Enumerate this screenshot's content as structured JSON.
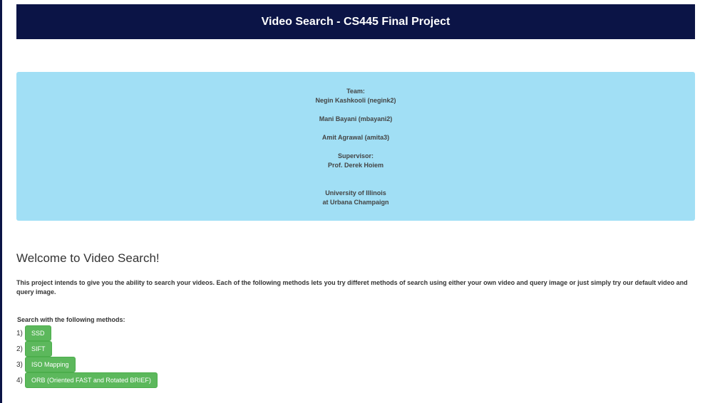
{
  "header": {
    "title": "Video Search - CS445 Final Project"
  },
  "team_box": {
    "team_label": "Team:",
    "members": [
      "Negin Kashkooli (negink2)",
      "Mani Bayani (mbayani2)",
      "Amit Agrawal (amita3)"
    ],
    "supervisor_label": "Supervisor:",
    "supervisor": "Prof. Derek Hoiem",
    "university_line1": "University of Illinois",
    "university_line2": "at Urbana Champaign"
  },
  "main": {
    "welcome": "Welcome to Video Search!",
    "intro": "This project intends to give you the ability to search your videos. Each of the following methods lets you try differet methods of search using either your own video and query image or just simply try our default video and query image.",
    "methods_label": "Search with the following methods:",
    "methods": [
      {
        "num": "1)",
        "label": "SSD"
      },
      {
        "num": "2)",
        "label": "SIFT"
      },
      {
        "num": "3)",
        "label": "ISO Mapping"
      },
      {
        "num": "4)",
        "label": "ORB (Oriented FAST and Rotated BRIEF)"
      }
    ]
  },
  "colors": {
    "header_bg": "#0b1446",
    "team_box_bg": "#a1dff5",
    "button_bg": "#5cb85c"
  }
}
